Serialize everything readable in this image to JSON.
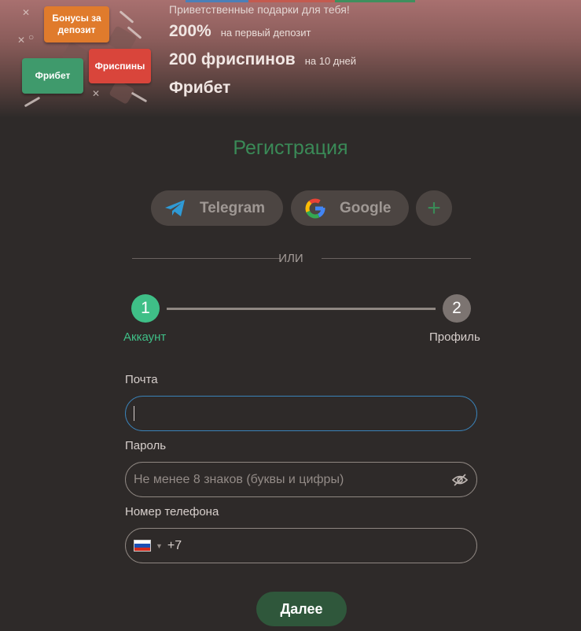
{
  "promo": {
    "greeting": "Приветственные подарки для тебя!",
    "offers": [
      {
        "big": "200%",
        "small": "на первый депозит"
      },
      {
        "big": "200 фриспинов",
        "small": "на 10 дней"
      },
      {
        "big": "Фрибет",
        "small": ""
      }
    ],
    "badges": {
      "deposit_bonus": "Бонусы за депозит",
      "freebet": "Фрибет",
      "freespins": "Фриспины"
    }
  },
  "form": {
    "title": "Регистрация",
    "social": {
      "telegram": "Telegram",
      "google": "Google",
      "more_icon": "plus-icon"
    },
    "divider_text": "ИЛИ",
    "steps": [
      {
        "number": "1",
        "label": "Аккаунт",
        "state": "active"
      },
      {
        "number": "2",
        "label": "Профиль",
        "state": "inactive"
      }
    ],
    "email": {
      "label": "Почта",
      "value": ""
    },
    "password": {
      "label": "Пароль",
      "placeholder": "Не менее 8 знаков (буквы и цифры)",
      "toggle_icon": "eye-off-icon"
    },
    "phone": {
      "label": "Номер телефона",
      "country_icon": "russia-flag-icon",
      "prefix": "+7"
    },
    "submit": "Далее"
  },
  "colors": {
    "accent_green": "#3a8a57",
    "step_active": "#3fbf87",
    "focus_blue": "#3a82b8"
  }
}
